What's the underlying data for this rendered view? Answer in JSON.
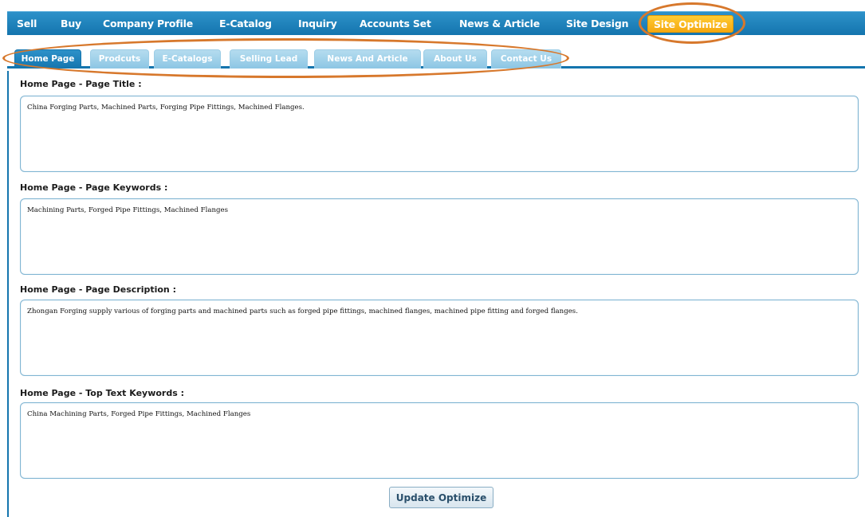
{
  "topnav": {
    "items": [
      "Sell",
      "Buy",
      "Company Profile",
      "E-Catalog",
      "Inquiry",
      "Accounts Set",
      "News & Article",
      "Site Design",
      "Site Optimize"
    ],
    "active": "Site Optimize"
  },
  "subtabs": {
    "items": [
      "Home Page",
      "Prodcuts",
      "E-Catalogs",
      "Selling Lead",
      "News And Article",
      "About Us",
      "Contact Us"
    ],
    "active": "Home Page"
  },
  "form": {
    "fields": [
      {
        "label": "Home Page - Page Title :",
        "value": "China Forging Parts, Machined Parts, Forging Pipe Fittings, Machined Flanges."
      },
      {
        "label": "Home Page - Page Keywords :",
        "value": "Machining Parts, Forged Pipe Fittings, Machined Flanges"
      },
      {
        "label": "Home Page - Page Description :",
        "value": "Zhongan Forging supply various of forging parts and machined parts such as forged pipe fittings, machined flanges, machined pipe fitting and forged flanges."
      },
      {
        "label": "Home Page - Top Text Keywords :",
        "value": "China Machining Parts, Forged Pipe Fittings, Machined Flanges"
      }
    ],
    "submit_label": "Update Optimize"
  },
  "colors": {
    "nav_blue": "#1475ae",
    "tab_light_blue": "#8cc6e4",
    "active_orange": "#f5a810",
    "highlight_oval": "#d7782c"
  }
}
